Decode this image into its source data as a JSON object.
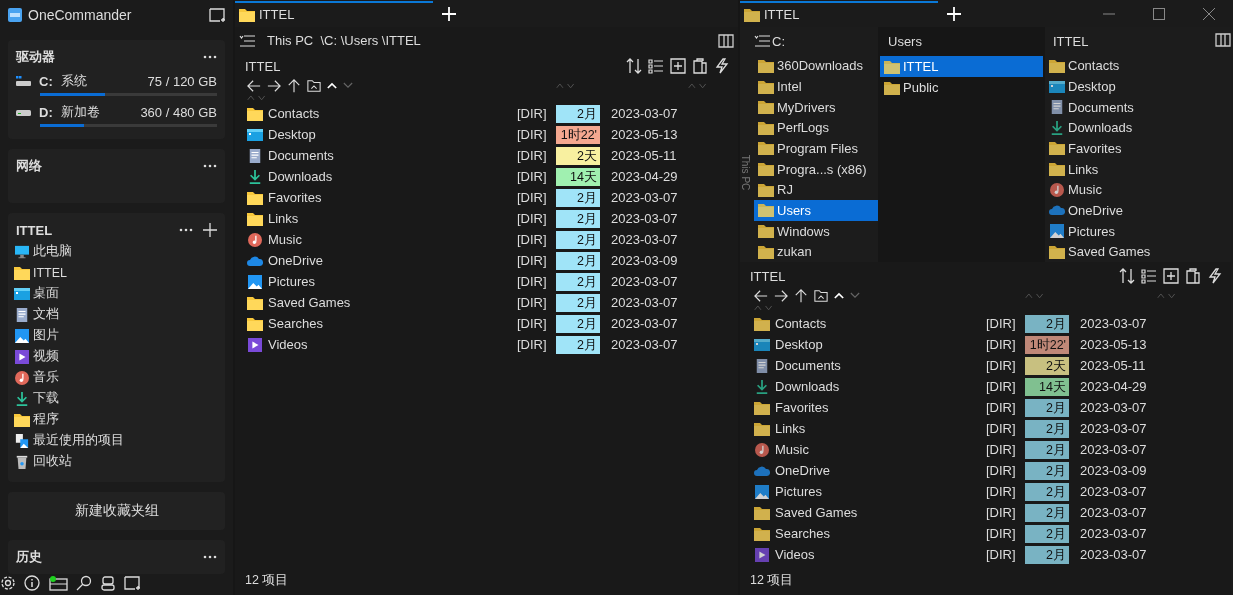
{
  "app": {
    "title": "OneCommander"
  },
  "sidebar": {
    "drives": {
      "title": "驱动器",
      "items": [
        {
          "letter": "C:",
          "label": "系统",
          "usage": "75 / 120 GB",
          "level": 0.37,
          "kind": "system"
        },
        {
          "letter": "D:",
          "label": "新加卷",
          "usage": "360 / 480 GB",
          "level": 0.25,
          "kind": "data"
        }
      ]
    },
    "network": {
      "title": "网络"
    },
    "favorites": {
      "title": "ITTEL",
      "items": [
        {
          "label": "此电脑",
          "kind": "pc"
        },
        {
          "label": "ITTEL",
          "kind": "folder"
        },
        {
          "label": "桌面",
          "kind": "desktop"
        },
        {
          "label": "文档",
          "kind": "documents"
        },
        {
          "label": "图片",
          "kind": "pictures"
        },
        {
          "label": "视频",
          "kind": "videos"
        },
        {
          "label": "音乐",
          "kind": "music"
        },
        {
          "label": "下载",
          "kind": "downloads"
        },
        {
          "label": "程序",
          "kind": "folder"
        },
        {
          "label": "最近使用的项目",
          "kind": "recent"
        },
        {
          "label": "回收站",
          "kind": "recycle"
        }
      ]
    },
    "new_group_button": "新建收藏夹组",
    "history": {
      "title": "历史"
    }
  },
  "left_pane": {
    "tabs": [
      {
        "label": "ITTEL",
        "selected": true
      }
    ],
    "breadcrumb": "This PC  \\C: \\Users \\ITTEL",
    "folder_title": "ITTEL",
    "files": [
      {
        "name": "Contacts",
        "kind": "folder",
        "type": "[DIR]",
        "age": "2月",
        "color": "#a0e4f8",
        "date": "2023-03-07"
      },
      {
        "name": "Desktop",
        "kind": "desktop",
        "type": "[DIR]",
        "age": "1时22'",
        "color": "#f4a890",
        "date": "2023-05-13"
      },
      {
        "name": "Documents",
        "kind": "documents",
        "type": "[DIR]",
        "age": "2天",
        "color": "#f8f0a0",
        "date": "2023-05-11"
      },
      {
        "name": "Downloads",
        "kind": "downloads",
        "type": "[DIR]",
        "age": "14天",
        "color": "#a0f0b0",
        "date": "2023-04-29"
      },
      {
        "name": "Favorites",
        "kind": "folder",
        "type": "[DIR]",
        "age": "2月",
        "color": "#a0e4f8",
        "date": "2023-03-07"
      },
      {
        "name": "Links",
        "kind": "folder",
        "type": "[DIR]",
        "age": "2月",
        "color": "#a0e4f8",
        "date": "2023-03-07"
      },
      {
        "name": "Music",
        "kind": "music",
        "type": "[DIR]",
        "age": "2月",
        "color": "#a0e4f8",
        "date": "2023-03-07"
      },
      {
        "name": "OneDrive",
        "kind": "onedrive",
        "type": "[DIR]",
        "age": "2月",
        "color": "#a0e4f8",
        "date": "2023-03-09"
      },
      {
        "name": "Pictures",
        "kind": "pictures",
        "type": "[DIR]",
        "age": "2月",
        "color": "#a0e4f8",
        "date": "2023-03-07"
      },
      {
        "name": "Saved Games",
        "kind": "folder",
        "type": "[DIR]",
        "age": "2月",
        "color": "#a0e4f8",
        "date": "2023-03-07"
      },
      {
        "name": "Searches",
        "kind": "folder",
        "type": "[DIR]",
        "age": "2月",
        "color": "#a0e4f8",
        "date": "2023-03-07"
      },
      {
        "name": "Videos",
        "kind": "videos",
        "type": "[DIR]",
        "age": "2月",
        "color": "#a0e4f8",
        "date": "2023-03-07"
      }
    ],
    "status": "12 项目"
  },
  "right_pane": {
    "tabs": [
      {
        "label": "ITTEL",
        "selected": true
      }
    ],
    "side_label": "This PC",
    "columns": [
      {
        "title": "C:",
        "items": [
          {
            "label": "360Downloads",
            "kind": "folder",
            "selected": false
          },
          {
            "label": "Intel",
            "kind": "folder",
            "selected": false
          },
          {
            "label": "MyDrivers",
            "kind": "folder",
            "selected": false
          },
          {
            "label": "PerfLogs",
            "kind": "folder",
            "selected": false
          },
          {
            "label": "Program Files",
            "kind": "folder",
            "selected": false
          },
          {
            "label": "Progra...s (x86)",
            "kind": "folder",
            "selected": false
          },
          {
            "label": "RJ",
            "kind": "folder",
            "selected": false
          },
          {
            "label": "Users",
            "kind": "folder",
            "selected": true
          },
          {
            "label": "Windows",
            "kind": "folder",
            "selected": false
          },
          {
            "label": "zukan",
            "kind": "folder",
            "selected": false
          }
        ]
      },
      {
        "title": "Users",
        "items": [
          {
            "label": "ITTEL",
            "kind": "folder",
            "selected": true
          },
          {
            "label": "Public",
            "kind": "folder",
            "selected": false
          }
        ]
      },
      {
        "title": "ITTEL",
        "items": [
          {
            "label": "Contacts",
            "kind": "folder",
            "selected": false
          },
          {
            "label": "Desktop",
            "kind": "desktop",
            "selected": false
          },
          {
            "label": "Documents",
            "kind": "documents",
            "selected": false
          },
          {
            "label": "Downloads",
            "kind": "downloads",
            "selected": false
          },
          {
            "label": "Favorites",
            "kind": "folder",
            "selected": false
          },
          {
            "label": "Links",
            "kind": "folder",
            "selected": false
          },
          {
            "label": "Music",
            "kind": "music",
            "selected": false
          },
          {
            "label": "OneDrive",
            "kind": "onedrive",
            "selected": false
          },
          {
            "label": "Pictures",
            "kind": "pictures",
            "selected": false
          },
          {
            "label": "Saved Games",
            "kind": "folder",
            "selected": false
          }
        ]
      }
    ],
    "folder_title": "ITTEL",
    "files": [
      {
        "name": "Contacts",
        "kind": "folder",
        "type": "[DIR]",
        "age": "2月",
        "color": "#79b3c3",
        "date": "2023-03-07"
      },
      {
        "name": "Desktop",
        "kind": "desktop",
        "type": "[DIR]",
        "age": "1时22'",
        "color": "#c08878",
        "date": "2023-05-13"
      },
      {
        "name": "Documents",
        "kind": "documents",
        "type": "[DIR]",
        "age": "2天",
        "color": "#c8c080",
        "date": "2023-05-11"
      },
      {
        "name": "Downloads",
        "kind": "downloads",
        "type": "[DIR]",
        "age": "14天",
        "color": "#80c090",
        "date": "2023-04-29"
      },
      {
        "name": "Favorites",
        "kind": "folder",
        "type": "[DIR]",
        "age": "2月",
        "color": "#79b3c3",
        "date": "2023-03-07"
      },
      {
        "name": "Links",
        "kind": "folder",
        "type": "[DIR]",
        "age": "2月",
        "color": "#79b3c3",
        "date": "2023-03-07"
      },
      {
        "name": "Music",
        "kind": "music",
        "type": "[DIR]",
        "age": "2月",
        "color": "#79b3c3",
        "date": "2023-03-07"
      },
      {
        "name": "OneDrive",
        "kind": "onedrive",
        "type": "[DIR]",
        "age": "2月",
        "color": "#79b3c3",
        "date": "2023-03-09"
      },
      {
        "name": "Pictures",
        "kind": "pictures",
        "type": "[DIR]",
        "age": "2月",
        "color": "#79b3c3",
        "date": "2023-03-07"
      },
      {
        "name": "Saved Games",
        "kind": "folder",
        "type": "[DIR]",
        "age": "2月",
        "color": "#79b3c3",
        "date": "2023-03-07"
      },
      {
        "name": "Searches",
        "kind": "folder",
        "type": "[DIR]",
        "age": "2月",
        "color": "#79b3c3",
        "date": "2023-03-07"
      },
      {
        "name": "Videos",
        "kind": "videos",
        "type": "[DIR]",
        "age": "2月",
        "color": "#79b3c3",
        "date": "2023-03-07"
      }
    ],
    "status": "12 项目"
  }
}
